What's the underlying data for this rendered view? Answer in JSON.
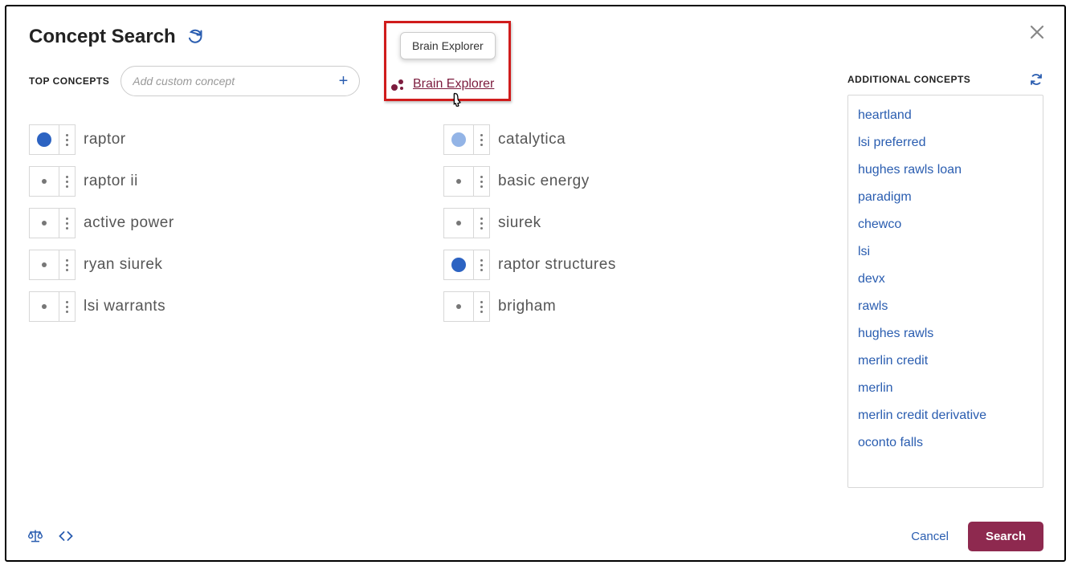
{
  "header": {
    "title": "Concept Search"
  },
  "top_row": {
    "section_label": "TOP CONCEPTS",
    "add_placeholder": "Add custom concept"
  },
  "tooltip": {
    "label": "Brain Explorer"
  },
  "brain_link": {
    "label": "Brain Explorer"
  },
  "colors": {
    "blue": "#2c63c2",
    "lightblue": "#93b4e6"
  },
  "concepts_left": [
    {
      "label": "raptor",
      "dot": "blue"
    },
    {
      "label": "raptor ii",
      "dot": "grey"
    },
    {
      "label": "active power",
      "dot": "grey"
    },
    {
      "label": "ryan siurek",
      "dot": "grey"
    },
    {
      "label": "lsi warrants",
      "dot": "grey"
    }
  ],
  "concepts_mid": [
    {
      "label": "catalytica",
      "dot": "lightblue"
    },
    {
      "label": "basic energy",
      "dot": "grey"
    },
    {
      "label": "siurek",
      "dot": "grey"
    },
    {
      "label": "raptor structures",
      "dot": "blue"
    },
    {
      "label": "brigham",
      "dot": "grey"
    }
  ],
  "right": {
    "title": "ADDITIONAL CONCEPTS",
    "items": [
      "heartland",
      "lsi preferred",
      "hughes rawls loan",
      "paradigm",
      "chewco",
      "lsi",
      "devx",
      "rawls",
      "hughes rawls",
      "merlin credit",
      "merlin",
      "merlin credit derivative",
      "oconto falls"
    ]
  },
  "footer": {
    "cancel": "Cancel",
    "search": "Search"
  }
}
